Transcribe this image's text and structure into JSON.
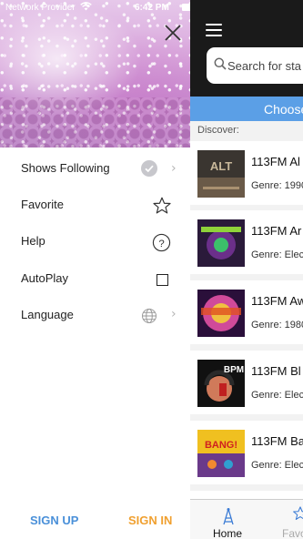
{
  "status_bar": {
    "carrier": "Network Provider",
    "time": "6:42 PM"
  },
  "drawer": {
    "menu_items": [
      {
        "label": "Shows Following",
        "icon": "checkmark-circle-icon",
        "has_chevron": true
      },
      {
        "label": "Favorite",
        "icon": "star-outline-icon",
        "has_chevron": false
      },
      {
        "label": "Help",
        "icon": "question-circle-icon",
        "has_chevron": false
      },
      {
        "label": "AutoPlay",
        "icon": "checkbox-icon",
        "has_chevron": false
      },
      {
        "label": "Language",
        "icon": "globe-icon",
        "has_chevron": true
      }
    ],
    "sign_up_label": "SIGN UP",
    "sign_in_label": "SIGN IN"
  },
  "main": {
    "search_placeholder": "Search for sta",
    "choose_label": "Choose",
    "discover_label": "Discover:",
    "stations": [
      {
        "name": "113FM Al",
        "genre": "Genre: 1990"
      },
      {
        "name": "113FM Ar",
        "genre": "Genre: Elec"
      },
      {
        "name": "113FM Aw",
        "genre": "Genre: 1980"
      },
      {
        "name": "113FM Bl",
        "genre": "Genre: Elec"
      },
      {
        "name": "113FM Ba",
        "genre": "Genre: Elec"
      }
    ],
    "tabs": {
      "home_label": "Home",
      "favorites_label": "Favo"
    }
  },
  "colors": {
    "accent_blue": "#4a90d9",
    "accent_orange": "#f0a030",
    "choose_bar": "#5b9fe6",
    "header_dark": "#1a1a1a"
  }
}
